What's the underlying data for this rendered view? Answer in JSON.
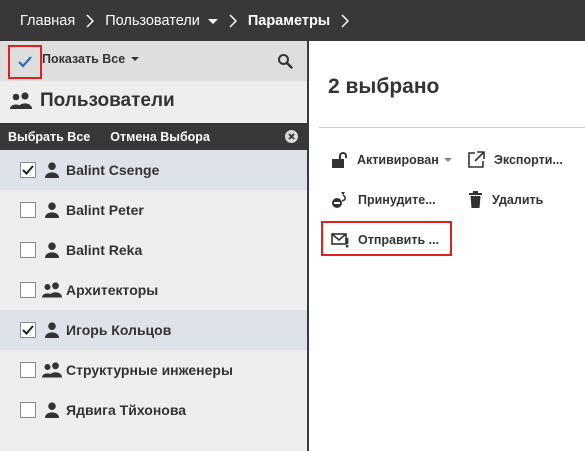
{
  "breadcrumb": {
    "home": "Главная",
    "users": "Пользователи",
    "params": "Параметры"
  },
  "filter": {
    "show_all_label": "Показать Все"
  },
  "users_panel": {
    "title": "Пользователи",
    "select_all": "Выбрать Все",
    "cancel_selection": "Отмена Выбора"
  },
  "list": [
    {
      "label": "Balint Csenge",
      "type": "user",
      "checked": true
    },
    {
      "label": "Balint Peter",
      "type": "user",
      "checked": false
    },
    {
      "label": "Balint Reka",
      "type": "user",
      "checked": false
    },
    {
      "label": "Архитекторы",
      "type": "group",
      "checked": false
    },
    {
      "label": "Игорь Кольцов",
      "type": "user",
      "checked": true
    },
    {
      "label": "Структурные инженеры",
      "type": "group",
      "checked": false
    },
    {
      "label": "Ядвига Тйхонова",
      "type": "user",
      "checked": false
    }
  ],
  "details": {
    "selected_count": "2 выбрано",
    "actions": {
      "activate": "Активирован",
      "export": "Экспорти...",
      "force": "Принудите...",
      "delete": "Удалить",
      "send": "Отправить ..."
    }
  },
  "colors": {
    "topbar": "#383838",
    "highlight_border": "#e02020",
    "check_accent": "#2a6db5"
  }
}
